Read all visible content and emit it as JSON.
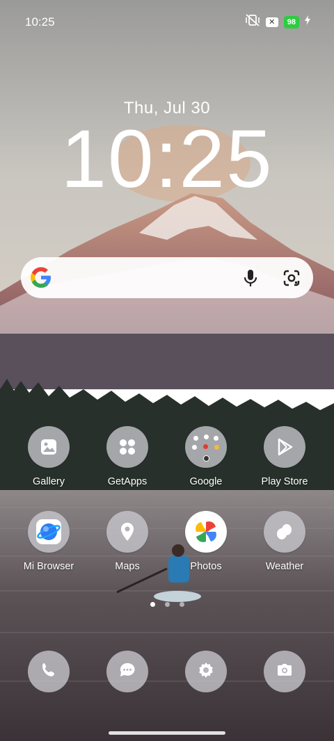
{
  "status": {
    "time": "10:25",
    "battery": "98",
    "icons": [
      "vibrate-off-icon",
      "x-badge-icon",
      "charging-bolt-icon"
    ]
  },
  "lockscreen": {
    "date": "Thu, Jul 30",
    "clock": "10:25"
  },
  "search": {
    "icons": [
      "google-g-logo",
      "mic-icon",
      "google-lens-icon"
    ]
  },
  "apps": [
    {
      "label": "Gallery",
      "icon": "gallery-icon"
    },
    {
      "label": "GetApps",
      "icon": "getapps-icon"
    },
    {
      "label": "Google",
      "icon": "folder-icon"
    },
    {
      "label": "Play Store",
      "icon": "play-store-icon"
    },
    {
      "label": "Mi Browser",
      "icon": "browser-icon"
    },
    {
      "label": "Maps",
      "icon": "maps-icon"
    },
    {
      "label": "Photos",
      "icon": "photos-icon"
    },
    {
      "label": "Weather",
      "icon": "weather-icon"
    }
  ],
  "dock": [
    {
      "icon": "phone-icon"
    },
    {
      "icon": "messages-icon"
    },
    {
      "icon": "settings-icon"
    },
    {
      "icon": "camera-icon"
    }
  ],
  "pager": {
    "pages": 3,
    "active": 1
  }
}
